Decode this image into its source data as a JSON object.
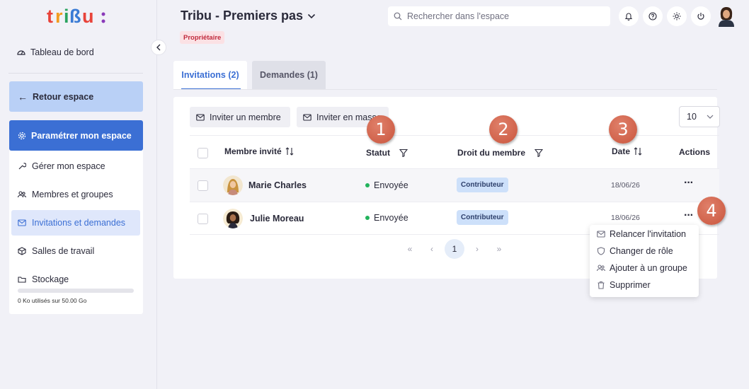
{
  "brand": {
    "logo_text": "tribu:",
    "accent": "#3b6fd4",
    "colors": [
      "#e8433a",
      "#f29c1f",
      "#2aa35f",
      "#3a7bd5",
      "#8a3ab9"
    ]
  },
  "sidebar": {
    "dashboard": "Tableau de bord",
    "back": "Retour espace",
    "settings": "Paramétrer mon espace",
    "items": [
      {
        "label": "Gérer mon espace",
        "icon": "wrench-icon"
      },
      {
        "label": "Membres et groupes",
        "icon": "users-icon"
      },
      {
        "label": "Invitations et demandes",
        "icon": "mail-icon"
      },
      {
        "label": "Salles de travail",
        "icon": "box-icon"
      },
      {
        "label": "Stockage",
        "icon": "folder-icon"
      }
    ],
    "storage_text": "0 Ko utilisés sur 50.00 Go",
    "storage_used": 0
  },
  "header": {
    "title": "Tribu - Premiers pas",
    "role_badge": "Propriétaire",
    "search_placeholder": "Rechercher dans l'espace"
  },
  "tabs": [
    {
      "label": "Invitations (2)",
      "active": true
    },
    {
      "label": "Demandes (1)",
      "active": false
    }
  ],
  "toolbar": {
    "invite": "Inviter un membre",
    "invite_bulk": "Inviter en masse",
    "page_size": "10"
  },
  "table": {
    "headers": {
      "member": "Membre invité",
      "status": "Statut",
      "role": "Droit du membre",
      "date": "Date",
      "actions": "Actions"
    },
    "rows": [
      {
        "name": "Marie Charles",
        "status": "Envoyée",
        "role": "Contributeur",
        "date": "18/06/26"
      },
      {
        "name": "Julie Moreau",
        "status": "Envoyée",
        "role": "Contributeur",
        "date": "18/06/26"
      }
    ]
  },
  "pagination": {
    "current": "1"
  },
  "actions_menu": [
    {
      "label": "Relancer l'invitation",
      "icon": "mail-icon"
    },
    {
      "label": "Changer de rôle",
      "icon": "shield-icon"
    },
    {
      "label": "Ajouter à un groupe",
      "icon": "users-icon"
    },
    {
      "label": "Supprimer",
      "icon": "trash-icon"
    }
  ],
  "markers": [
    "1",
    "2",
    "3",
    "4"
  ]
}
